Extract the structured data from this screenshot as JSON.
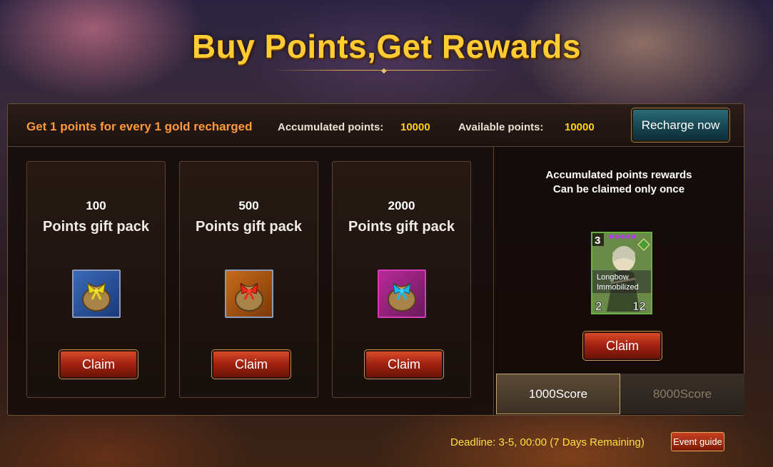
{
  "title": "Buy Points,Get Rewards",
  "header": {
    "promo": "Get 1 points for every 1 gold recharged",
    "accumulated_label": "Accumulated points:",
    "accumulated_value": "10000",
    "available_label": "Available points:",
    "available_value": "10000",
    "recharge_label": "Recharge now"
  },
  "packs": [
    {
      "points": "100",
      "label": "Points gift pack",
      "ribbon_color": "#e8d81a",
      "frame_color": "#8a9ab8",
      "claim_label": "Claim"
    },
    {
      "points": "500",
      "label": "Points gift pack",
      "ribbon_color": "#e82a1a",
      "frame_color": "#8a9ab8",
      "claim_label": "Claim"
    },
    {
      "points": "2000",
      "label": "Points gift pack",
      "ribbon_color": "#1ab8f0",
      "frame_color": "#d83ab8",
      "claim_label": "Claim"
    }
  ],
  "rewards": {
    "title_line1": "Accumulated points rewards",
    "title_line2": "Can be claimed only once",
    "card": {
      "level": "3",
      "skill1": "Longbow",
      "skill2": "Immobilized",
      "attack": "2",
      "health": "12"
    },
    "claim_label": "Claim",
    "tabs": [
      {
        "label": "1000Score",
        "active": true
      },
      {
        "label": "8000Score",
        "active": false
      }
    ]
  },
  "footer": {
    "deadline": "Deadline: 3-5, 00:00 (7 Days Remaining)",
    "guide_label": "Event guide"
  }
}
